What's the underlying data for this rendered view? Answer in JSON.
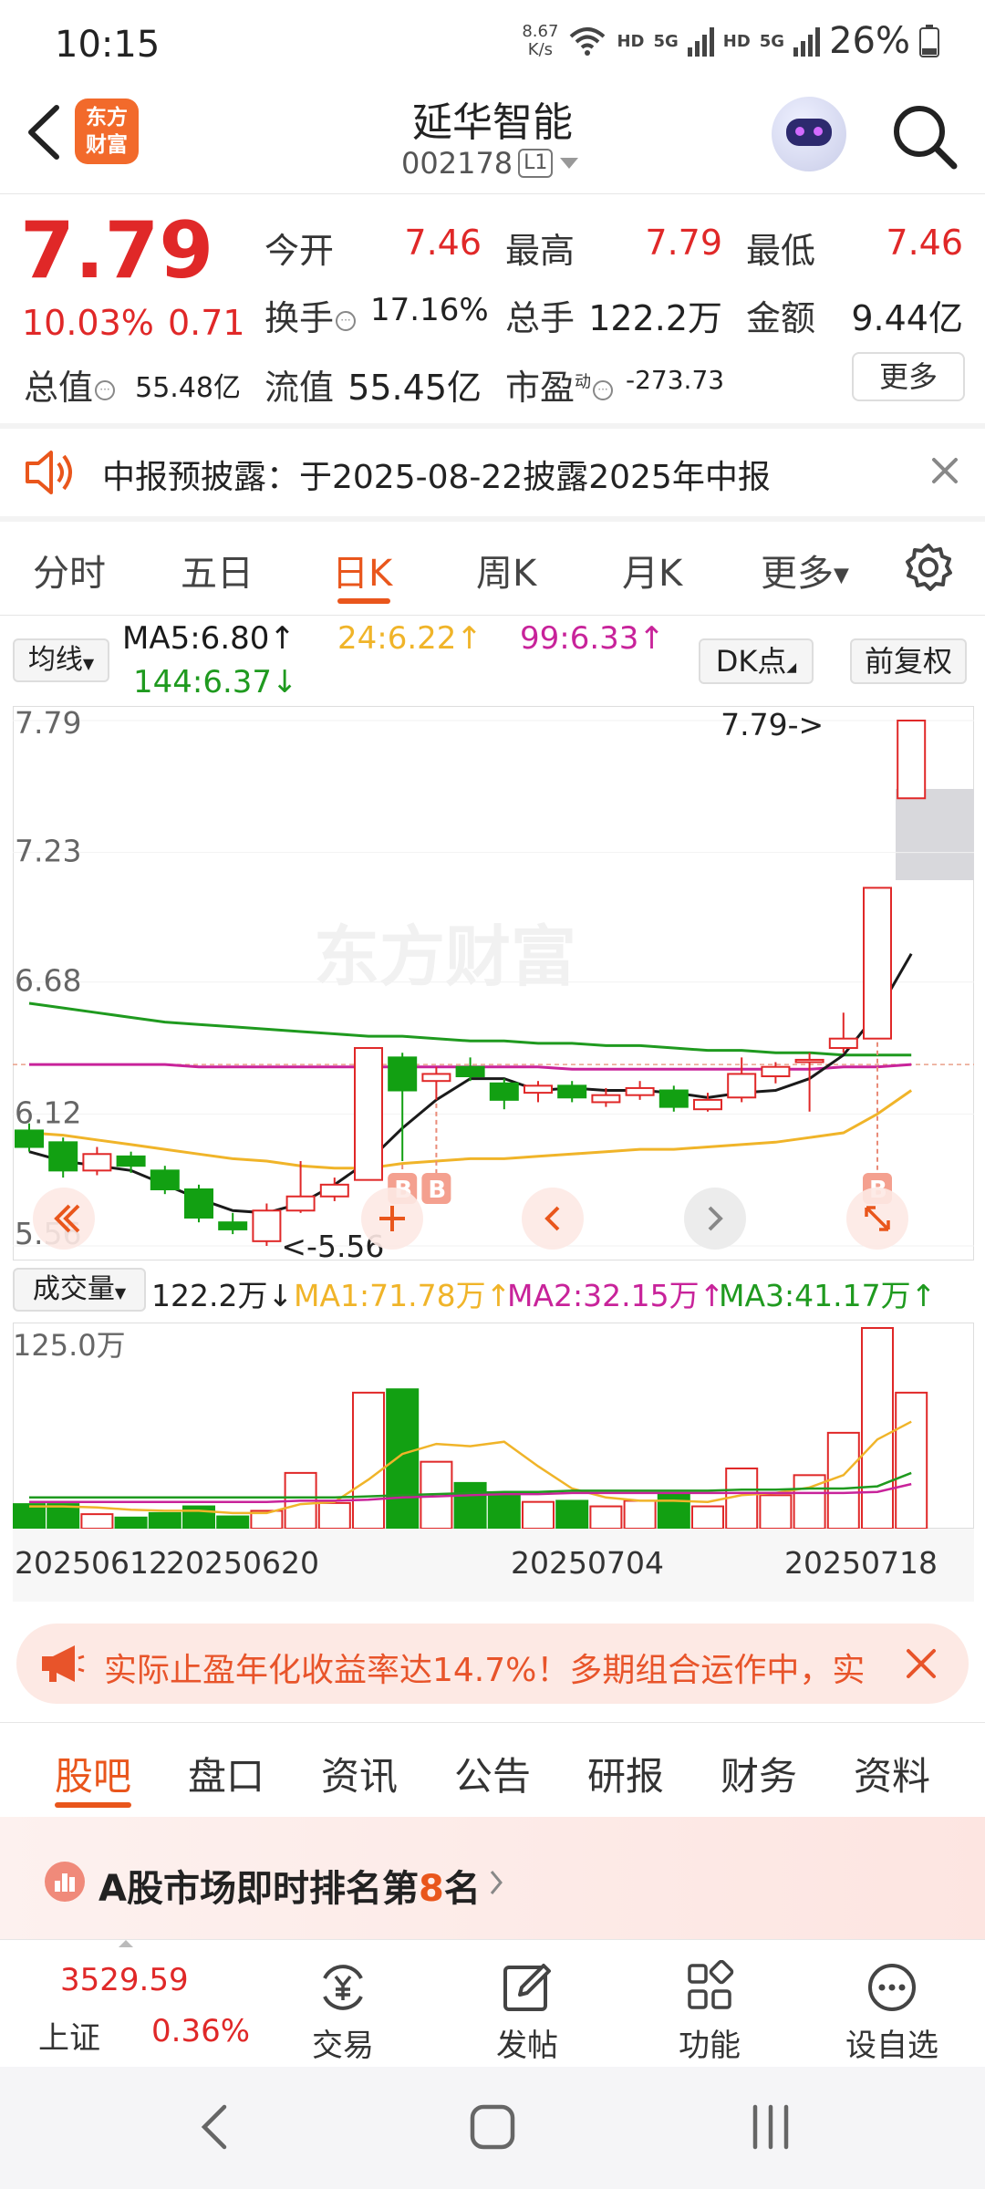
{
  "status_bar": {
    "time": "10:15",
    "net_speed_value": "8.67",
    "net_speed_unit": "K/s",
    "hd1": "HD",
    "sig1": "5G",
    "hd2": "HD",
    "sig2": "5G",
    "battery": "26%"
  },
  "header": {
    "logo_line1": "东方",
    "logo_line2": "财富",
    "stock_name": "延华智能",
    "stock_code": "002178",
    "level": "L1"
  },
  "quote": {
    "last_price": "7.79",
    "change_pct": "10.03%",
    "change_amt": "0.71",
    "open_label": "今开",
    "open": "7.46",
    "high_label": "最高",
    "high": "7.79",
    "low_label": "最低",
    "low": "7.46",
    "turnover_label": "换手",
    "turnover": "17.16%",
    "volume_label": "总手",
    "volume": "122.2万",
    "amount_label": "金额",
    "amount": "9.44亿",
    "mcap_label": "总值",
    "mcap": "55.48亿",
    "float_label": "流值",
    "float": "55.45亿",
    "pe_label": "市盈",
    "pe_sup": "动",
    "pe": "-273.73",
    "more": "更多"
  },
  "notice": {
    "text": "中报预披露：于2025-08-22披露2025年中报"
  },
  "period_tabs": [
    "分时",
    "五日",
    "日K",
    "周K",
    "月K",
    "更多"
  ],
  "ma_legend": {
    "selector": "均线",
    "ma5": "MA5:6.80↑",
    "ma24": "24:6.22↑",
    "ma99": "99:6.33↑",
    "ma144": "144:6.37↓",
    "dk_button": "DK点",
    "adjust_button": "前复权"
  },
  "chart_data": [
    {
      "type": "candlestick",
      "y_ticks": [
        "7.79",
        "7.23",
        "6.68",
        "6.12",
        "5.56"
      ],
      "ylim": [
        5.56,
        7.79
      ],
      "candles": [
        {
          "o": 6.05,
          "c": 5.98,
          "h": 6.08,
          "l": 5.96
        },
        {
          "o": 6.0,
          "c": 5.88,
          "h": 6.02,
          "l": 5.85
        },
        {
          "o": 5.88,
          "c": 5.95,
          "h": 5.98,
          "l": 5.86
        },
        {
          "o": 5.94,
          "c": 5.9,
          "h": 5.96,
          "l": 5.87
        },
        {
          "o": 5.88,
          "c": 5.8,
          "h": 5.9,
          "l": 5.78
        },
        {
          "o": 5.8,
          "c": 5.68,
          "h": 5.82,
          "l": 5.66
        },
        {
          "o": 5.66,
          "c": 5.63,
          "h": 5.7,
          "l": 5.61
        },
        {
          "o": 5.58,
          "c": 5.71,
          "h": 5.74,
          "l": 5.56
        },
        {
          "o": 5.71,
          "c": 5.77,
          "h": 5.92,
          "l": 5.7
        },
        {
          "o": 5.77,
          "c": 5.82,
          "h": 5.85,
          "l": 5.75
        },
        {
          "o": 5.84,
          "c": 6.4,
          "h": 6.4,
          "l": 5.84
        },
        {
          "o": 6.36,
          "c": 6.22,
          "h": 6.38,
          "l": 5.92
        },
        {
          "o": 6.26,
          "c": 6.29,
          "h": 6.32,
          "l": 6.18
        },
        {
          "o": 6.32,
          "c": 6.28,
          "h": 6.36,
          "l": 6.26
        },
        {
          "o": 6.25,
          "c": 6.18,
          "h": 6.27,
          "l": 6.14
        },
        {
          "o": 6.21,
          "c": 6.24,
          "h": 6.26,
          "l": 6.17
        },
        {
          "o": 6.24,
          "c": 6.19,
          "h": 6.26,
          "l": 6.17
        },
        {
          "o": 6.17,
          "c": 6.2,
          "h": 6.23,
          "l": 6.15
        },
        {
          "o": 6.2,
          "c": 6.23,
          "h": 6.26,
          "l": 6.18
        },
        {
          "o": 6.22,
          "c": 6.15,
          "h": 6.24,
          "l": 6.13
        },
        {
          "o": 6.14,
          "c": 6.18,
          "h": 6.21,
          "l": 6.13
        },
        {
          "o": 6.19,
          "c": 6.29,
          "h": 6.36,
          "l": 6.17
        },
        {
          "o": 6.28,
          "c": 6.32,
          "h": 6.34,
          "l": 6.25
        },
        {
          "o": 6.34,
          "c": 6.35,
          "h": 6.38,
          "l": 6.13
        },
        {
          "o": 6.4,
          "c": 6.44,
          "h": 6.55,
          "l": 6.38
        },
        {
          "o": 6.44,
          "c": 7.08,
          "h": 7.08,
          "l": 6.44
        },
        {
          "o": 7.46,
          "c": 7.79,
          "h": 7.79,
          "l": 7.46
        }
      ],
      "ma5": [
        5.96,
        5.92,
        5.9,
        5.88,
        5.82,
        5.76,
        5.71,
        5.7,
        5.74,
        5.82,
        5.92,
        6.06,
        6.18,
        6.27,
        6.27,
        6.22,
        6.23,
        6.22,
        6.22,
        6.21,
        6.19,
        6.21,
        6.22,
        6.27,
        6.37,
        6.55,
        6.8
      ],
      "ma24": [
        6.04,
        6.03,
        6.01,
        5.99,
        5.97,
        5.95,
        5.93,
        5.92,
        5.9,
        5.89,
        5.89,
        5.91,
        5.92,
        5.93,
        5.93,
        5.94,
        5.95,
        5.96,
        5.97,
        5.97,
        5.98,
        5.99,
        6.0,
        6.02,
        6.04,
        6.12,
        6.22
      ],
      "ma99": [
        6.33,
        6.33,
        6.33,
        6.33,
        6.33,
        6.32,
        6.32,
        6.32,
        6.32,
        6.32,
        6.32,
        6.32,
        6.32,
        6.32,
        6.32,
        6.32,
        6.31,
        6.31,
        6.31,
        6.31,
        6.31,
        6.31,
        6.31,
        6.31,
        6.32,
        6.32,
        6.33
      ],
      "ma144": [
        6.59,
        6.57,
        6.55,
        6.53,
        6.51,
        6.5,
        6.49,
        6.48,
        6.47,
        6.46,
        6.45,
        6.45,
        6.44,
        6.43,
        6.43,
        6.42,
        6.42,
        6.41,
        6.41,
        6.4,
        6.39,
        6.39,
        6.38,
        6.38,
        6.37,
        6.37,
        6.37
      ],
      "b_markers": [
        11,
        12,
        25
      ],
      "low_marker": "<-5.56",
      "high_marker": "7.79->",
      "watermark": "东方财富"
    },
    {
      "type": "bar",
      "title": "成交量",
      "y_ticks": [
        "125.0万"
      ],
      "ylim": [
        0,
        125
      ],
      "volumes": [
        22,
        22,
        13,
        10,
        14,
        20,
        11,
        16,
        50,
        23,
        122,
        125,
        60,
        41,
        32,
        24,
        25,
        20,
        25,
        32,
        20,
        54,
        30,
        48,
        86,
        180,
        122
      ],
      "ma1": [
        20,
        20,
        19,
        17,
        16,
        16,
        14,
        14,
        22,
        24,
        44,
        67,
        76,
        74,
        78,
        56,
        36,
        28,
        25,
        25,
        24,
        30,
        32,
        37,
        48,
        80,
        96
      ],
      "ma2": [
        24,
        24,
        24,
        24,
        24,
        24,
        24,
        24,
        25,
        25,
        26,
        28,
        29,
        30,
        31,
        31,
        32,
        32,
        32,
        32,
        32,
        32,
        32,
        32,
        32,
        33,
        40
      ],
      "ma3": [
        28,
        28,
        28,
        28,
        28,
        28,
        28,
        28,
        28,
        28,
        29,
        30,
        31,
        32,
        33,
        33,
        34,
        34,
        34,
        34,
        34,
        35,
        35,
        36,
        36,
        38,
        50
      ]
    }
  ],
  "volume_legend": {
    "selector": "成交量",
    "volume": "122.2万↓",
    "ma1": "MA1:71.78万↑",
    "ma2": "MA2:32.15万↑",
    "ma3": "MA3:41.17万↑"
  },
  "date_axis": [
    "20250612",
    "20250620",
    "20250704",
    "20250718"
  ],
  "promo": {
    "text": "实际止盈年化收益率达14.7%！多期组合运作中，实"
  },
  "bottom_tabs": [
    "股吧",
    "盘口",
    "资讯",
    "公告",
    "研报",
    "财务",
    "资料"
  ],
  "rank": {
    "prefix": "A股市场即时排名第",
    "rank": "8",
    "suffix": "名"
  },
  "toolbar": {
    "index_value": "3529.59",
    "index_name": "上证",
    "index_change": "0.36%",
    "trade": "交易",
    "post": "发帖",
    "function": "功能",
    "watchlist": "设自选"
  },
  "colors": {
    "up": "#e02828",
    "down": "#12a012",
    "accent": "#e9561c",
    "ma24": "#f0b429",
    "ma99": "#c8239a",
    "ma144": "#1f9a1f",
    "ma5": "#1a1a1a"
  }
}
